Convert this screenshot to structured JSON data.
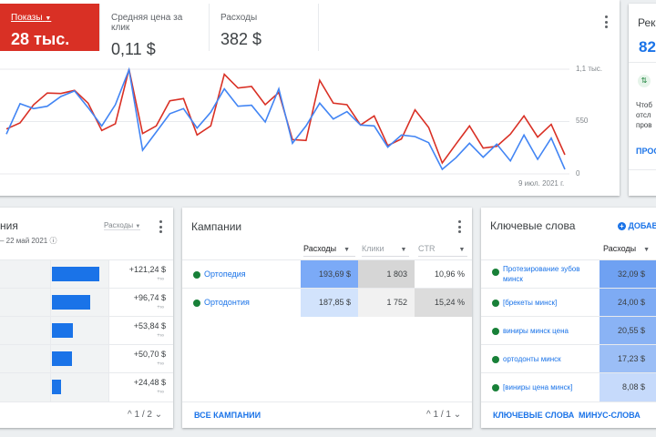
{
  "metrics": [
    {
      "label": "Показы",
      "value": "28 тыс.",
      "selected": true
    },
    {
      "label": "Средняя цена за клик",
      "value": "0,11 $"
    },
    {
      "label": "Расходы",
      "value": "382 $"
    }
  ],
  "chart_data": {
    "type": "line",
    "y_ticks": [
      "1,1 тыс.",
      "550",
      "0"
    ],
    "ylim": [
      0,
      1100
    ],
    "x_label_end": "9 июл. 2021 г.",
    "series": [
      {
        "name": "red",
        "color": "#d93025",
        "values": [
          472,
          536,
          727,
          849,
          845,
          877,
          743,
          456,
          526,
          1100,
          424,
          504,
          768,
          791,
          408,
          504,
          1046,
          902,
          918,
          727,
          855,
          360,
          351,
          983,
          743,
          727,
          514,
          609,
          297,
          367,
          673,
          488,
          115,
          313,
          504,
          271,
          290,
          418,
          609,
          386,
          520,
          201
        ]
      },
      {
        "name": "blue",
        "color": "#4285f4",
        "values": [
          418,
          737,
          686,
          711,
          813,
          871,
          696,
          504,
          727,
          1094,
          249,
          440,
          632,
          686,
          481,
          648,
          893,
          711,
          721,
          545,
          893,
          322,
          504,
          743,
          577,
          654,
          514,
          504,
          281,
          408,
          392,
          328,
          48,
          169,
          322,
          175,
          313,
          137,
          408,
          153,
          376,
          48
        ]
      }
    ]
  },
  "reco": {
    "title": "Рек",
    "score": "82,",
    "text1": "Чтоб",
    "text2": "отсл",
    "text3": "пров",
    "link": "ПРОС"
  },
  "changes": {
    "title": "ния",
    "subtitle": "– 22 май 2021",
    "metric": "Расходы",
    "pager": "1 / 2",
    "rows": [
      {
        "value": "+121,24 $",
        "fraction": 1.0
      },
      {
        "value": "+96,74 $",
        "fraction": 0.8
      },
      {
        "value": "+53,84 $",
        "fraction": 0.44
      },
      {
        "value": "+50,70 $",
        "fraction": 0.42
      },
      {
        "value": "+24,48 $",
        "fraction": 0.2
      }
    ]
  },
  "campaigns": {
    "title": "Кампании",
    "columns": [
      "Расходы",
      "Клики",
      "CTR"
    ],
    "pager": "1 / 1",
    "footer": "ВСЕ КАМПАНИИ",
    "rows": [
      {
        "name": "Ортопедия",
        "cost": "193,69 $",
        "clicks": "1 803",
        "ctr": "10,96 %"
      },
      {
        "name": "Ортодонтия",
        "cost": "187,85 $",
        "clicks": "1 752",
        "ctr": "15,24 %"
      }
    ]
  },
  "keywords": {
    "title": "Ключевые слова",
    "add": "ДОБАВ",
    "column": "Расходы",
    "footer1": "КЛЮЧЕВЫЕ СЛОВА",
    "footer2": "МИНУС-СЛОВА",
    "rows": [
      {
        "name": "Протезирование зубов минск",
        "cost": "32,09 $"
      },
      {
        "name": "[брекеты минск]",
        "cost": "24,00 $"
      },
      {
        "name": "виниры минск цена",
        "cost": "20,55 $"
      },
      {
        "name": "ортодонты минск",
        "cost": "17,23 $"
      },
      {
        "name": "[виниры цена минск]",
        "cost": "8,08 $"
      }
    ]
  }
}
